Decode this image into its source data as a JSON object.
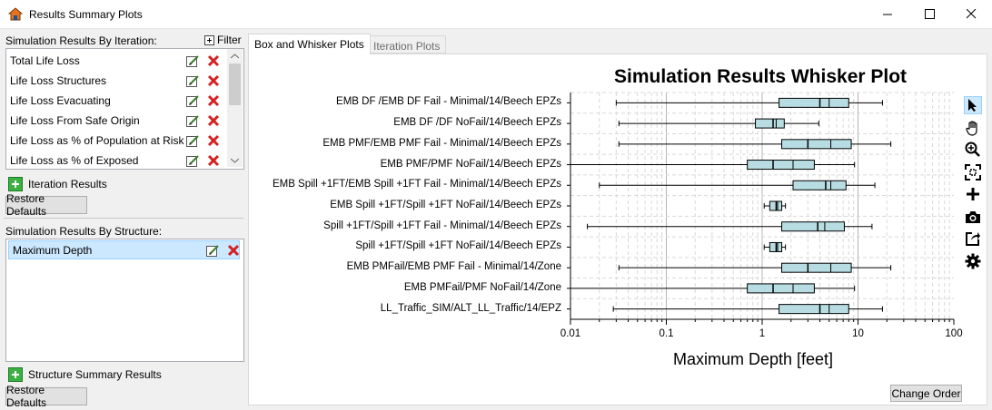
{
  "window": {
    "title": "Results Summary Plots"
  },
  "left": {
    "iteration_label": "Simulation Results By Iteration:",
    "filter_label": "Filter",
    "iteration_items": [
      "Total Life Loss",
      "Life Loss Structures",
      "Life Loss Evacuating",
      "Life Loss From Safe Origin",
      "Life Loss as % of Population at Risk",
      "Life Loss as % of Exposed"
    ],
    "iteration_results_label": "Iteration Results",
    "restore_defaults_1": "Restore Defaults",
    "structure_label": "Simulation Results By Structure:",
    "structure_items": [
      "Maximum Depth"
    ],
    "structure_summary_label": "Structure Summary Results",
    "restore_defaults_2": "Restore Defaults"
  },
  "tabs": [
    {
      "label": "Box and Whisker Plots",
      "active": true
    },
    {
      "label": "Iteration Plots",
      "active": false
    }
  ],
  "change_order_label": "Change Order",
  "toolbar_icons": [
    "pointer-icon",
    "pan-hand-icon",
    "zoom-in-icon",
    "fit-extents-icon",
    "crosshair-plus-icon",
    "camera-icon",
    "export-icon",
    "gear-icon"
  ],
  "chart_data": {
    "type": "box",
    "title": "Simulation Results Whisker Plot",
    "xlabel": "Maximum Depth [feet]",
    "xscale": "log",
    "xlim": [
      0.01,
      100
    ],
    "xticks": [
      "0.01",
      "0.1",
      "1",
      "10",
      "100"
    ],
    "grid": true,
    "categories": [
      "EMB DF /EMB DF Fail - Minimal/14/Beech EPZs",
      "EMB DF /DF NoFail/14/Beech EPZs",
      "EMB PMF/EMB PMF Fail - Minimal/14/Beech EPZs",
      "EMB PMF/PMF NoFail/14/Beech EPZs",
      "EMB Spill +1FT/EMB Spill +1FT Fail - Minimal/14/Beech EPZs",
      "EMB Spill +1FT/Spill +1FT NoFail/14/Beech EPZs",
      "Spill +1FT/Spill +1FT Fail - Minimal/14/Beech EPZs",
      "Spill +1FT/Spill +1FT NoFail/14/Beech EPZs",
      "EMB PMFail/EMB PMF Fail - Minimal/14/Zone",
      "EMB PMFail/PMF NoFail/14/Zone",
      "LL_Traffic_SIM/ALT_LL_Traffic/14/EPZ"
    ],
    "boxes": [
      {
        "min": 0.03,
        "q1": 1.5,
        "median": 4.0,
        "q3": 8.0,
        "max": 18,
        "mean": 5.0
      },
      {
        "min": 0.032,
        "q1": 0.85,
        "median": 1.3,
        "q3": 1.7,
        "max": 3.9,
        "mean": 1.4
      },
      {
        "min": 0.032,
        "q1": 1.6,
        "median": 3.0,
        "q3": 8.5,
        "max": 22,
        "mean": 5.2
      },
      {
        "min": 0.01,
        "q1": 0.7,
        "median": 1.3,
        "q3": 3.5,
        "max": 9.2,
        "mean": 2.1
      },
      {
        "min": 0.02,
        "q1": 2.1,
        "median": 4.6,
        "q3": 7.5,
        "max": 15,
        "mean": 5.2
      },
      {
        "min": 1.05,
        "q1": 1.2,
        "median": 1.4,
        "q3": 1.6,
        "max": 1.75,
        "mean": 1.45
      },
      {
        "min": 0.015,
        "q1": 1.6,
        "median": 3.8,
        "q3": 7.2,
        "max": 14,
        "mean": 4.5
      },
      {
        "min": 1.05,
        "q1": 1.2,
        "median": 1.4,
        "q3": 1.6,
        "max": 1.75,
        "mean": 1.45
      },
      {
        "min": 0.032,
        "q1": 1.6,
        "median": 3.0,
        "q3": 8.5,
        "max": 22,
        "mean": 5.2
      },
      {
        "min": 0.01,
        "q1": 0.7,
        "median": 1.3,
        "q3": 3.5,
        "max": 9.2,
        "mean": 2.1
      },
      {
        "min": 0.028,
        "q1": 1.5,
        "median": 4.0,
        "q3": 8.0,
        "max": 18,
        "mean": 5.0
      }
    ],
    "box_color": "#b7dde3"
  }
}
